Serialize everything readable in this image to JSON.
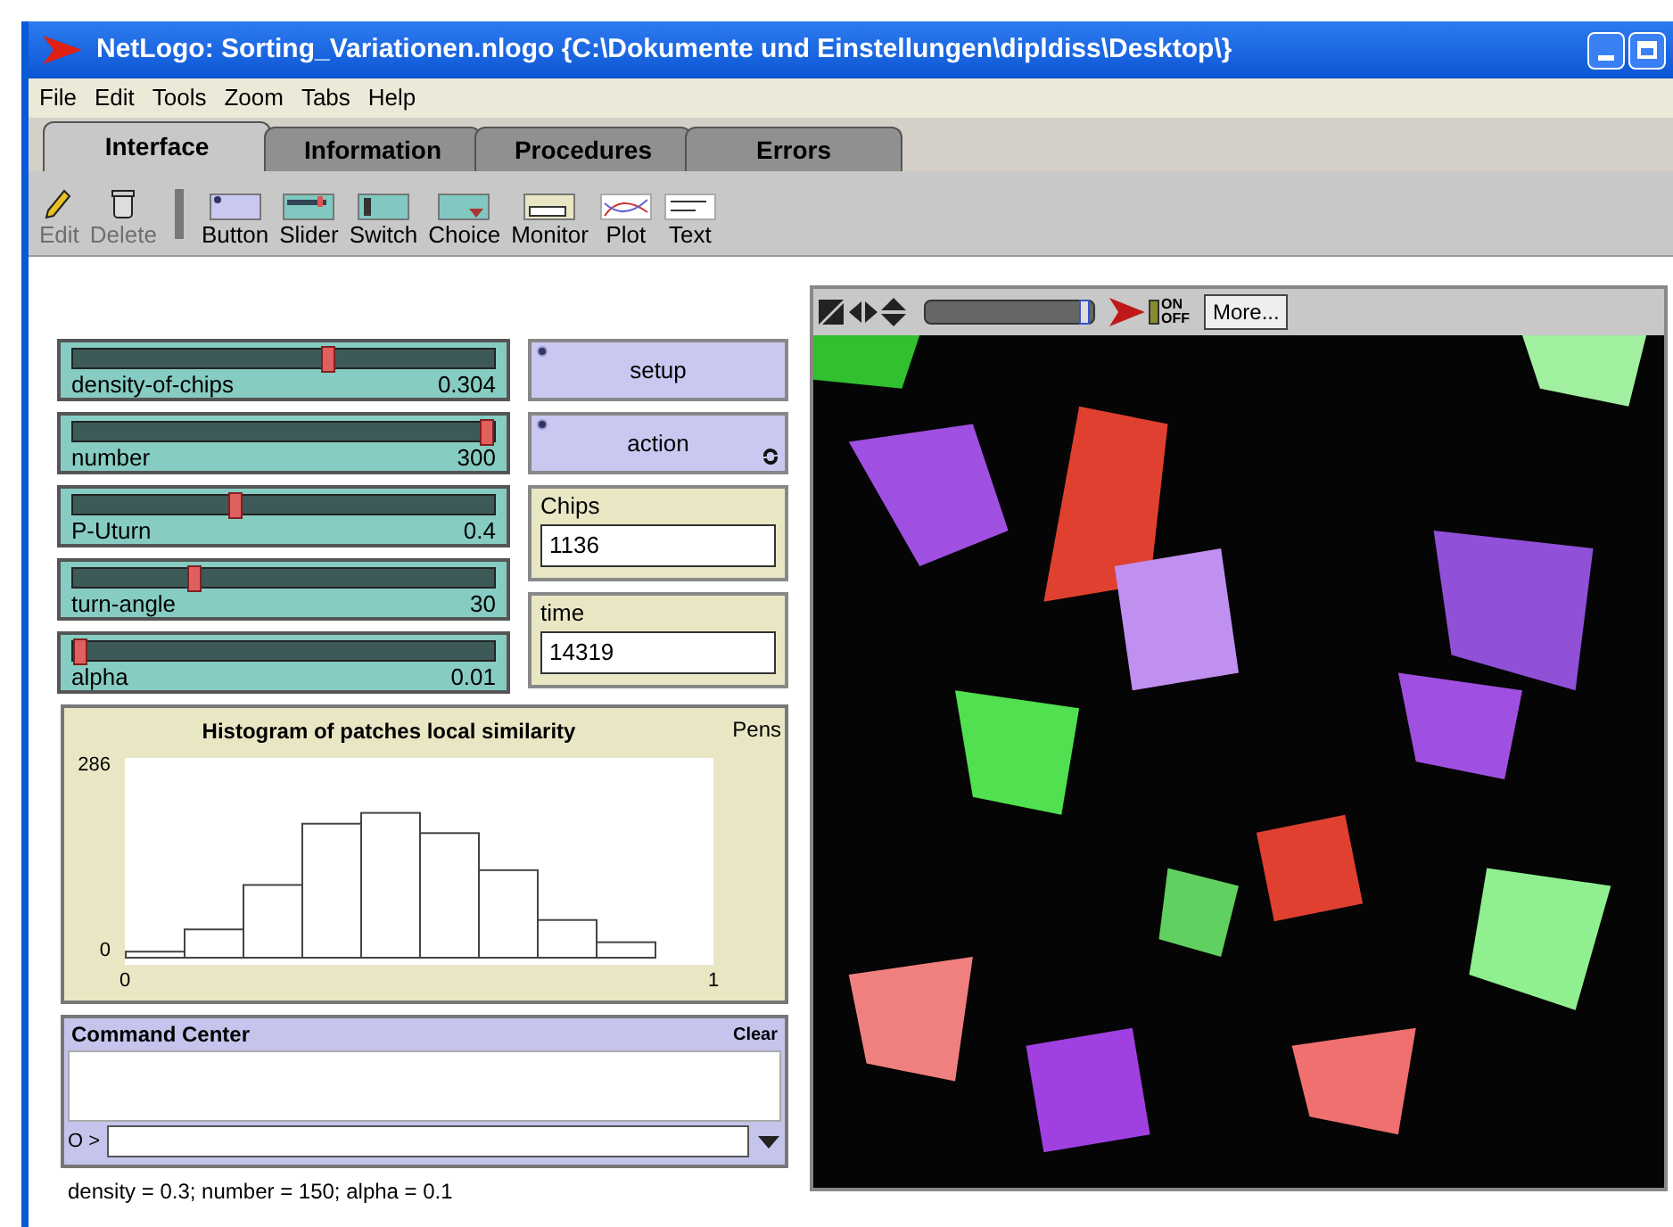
{
  "window": {
    "title": "NetLogo: Sorting_Variationen.nlogo {C:\\Dokumente und Einstellungen\\dipldiss\\Desktop\\}"
  },
  "menu": [
    "File",
    "Edit",
    "Tools",
    "Zoom",
    "Tabs",
    "Help"
  ],
  "tabs": [
    {
      "label": "Interface",
      "selected": true
    },
    {
      "label": "Information",
      "selected": false
    },
    {
      "label": "Procedures",
      "selected": false
    },
    {
      "label": "Errors",
      "selected": false
    }
  ],
  "toolbar": [
    {
      "label": "Edit",
      "disabled": true,
      "kind": "pencil"
    },
    {
      "label": "Delete",
      "disabled": true,
      "kind": "trash"
    },
    {
      "label": "Button",
      "disabled": false,
      "kind": "button"
    },
    {
      "label": "Slider",
      "disabled": false,
      "kind": "slider"
    },
    {
      "label": "Switch",
      "disabled": false,
      "kind": "switch"
    },
    {
      "label": "Choice",
      "disabled": false,
      "kind": "choice"
    },
    {
      "label": "Monitor",
      "disabled": false,
      "kind": "monitor"
    },
    {
      "label": "Plot",
      "disabled": false,
      "kind": "plot"
    },
    {
      "label": "Text",
      "disabled": false,
      "kind": "text"
    }
  ],
  "sliders": [
    {
      "name": "density-of-chips",
      "value": "0.304",
      "level": 0.61
    },
    {
      "name": "number",
      "value": "300",
      "level": 1
    },
    {
      "name": "P-Uturn",
      "value": "0.4",
      "level": 0.38
    },
    {
      "name": "turn-angle",
      "value": "30",
      "level": 0.28
    },
    {
      "name": "alpha",
      "value": "0.01",
      "level": 0
    }
  ],
  "buttons": [
    {
      "label": "setup",
      "forever": false
    },
    {
      "label": "action",
      "forever": true
    }
  ],
  "monitors": [
    {
      "label": "Chips",
      "value": "1136"
    },
    {
      "label": "time",
      "value": "14319"
    }
  ],
  "plot": {
    "pens_label": "Pens",
    "chart_data": {
      "type": "bar",
      "title": "Histogram of patches local similarity",
      "x": [
        0.05,
        0.15,
        0.25,
        0.35,
        0.45,
        0.55,
        0.65,
        0.75,
        0.85,
        0.95
      ],
      "values": [
        9,
        42,
        108,
        199,
        215,
        185,
        130,
        56,
        23,
        0
      ],
      "xlim": [
        0,
        1
      ],
      "ylim": [
        0,
        286
      ],
      "xticks": [
        0,
        1
      ],
      "yticks": [
        0,
        286
      ]
    }
  },
  "command_center": {
    "title": "Command Center",
    "clear": "Clear",
    "prompt": "O >"
  },
  "status_text": "density = 0.3; number = 150; alpha = 0.1",
  "view_toolbar": {
    "more": "More...",
    "switch_on": "ON",
    "switch_off": "OFF",
    "view_updates": true,
    "speed_slider": {
      "level": 0.98
    }
  }
}
